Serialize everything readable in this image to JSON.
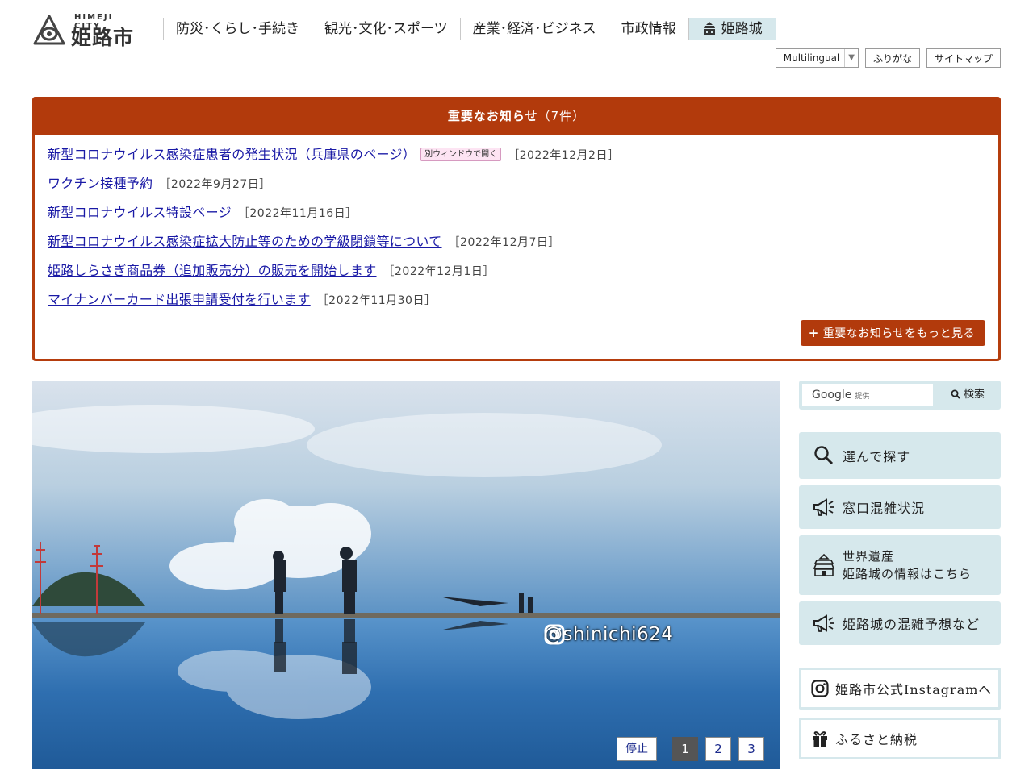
{
  "header": {
    "logo_en": "HIMEJI CITY",
    "logo_ja": "姫路市",
    "nav": [
      "防災･くらし･手続き",
      "観光･文化･スポーツ",
      "産業･経済･ビジネス",
      "市政情報",
      "姫路城"
    ],
    "util": {
      "multilingual": "Multilingual",
      "furigana": "ふりがな",
      "sitemap": "サイトマップ"
    }
  },
  "notices": {
    "title": "重要なお知らせ",
    "count": "（7件）",
    "new_window_badge": "別ウィンドウで開く",
    "items": [
      {
        "title": "新型コロナウイルス感染症患者の発生状況（兵庫県のページ）",
        "date": "［2022年12月2日］"
      },
      {
        "title": "ワクチン接種予約",
        "date": "［2022年9月27日］"
      },
      {
        "title": "新型コロナウイルス特設ページ",
        "date": "［2022年11月16日］"
      },
      {
        "title": "新型コロナウイルス感染症拡大防止等のための学級閉鎖等について",
        "date": "［2022年12月7日］"
      },
      {
        "title": "姫路しらさぎ商品券（追加販売分）の販売を開始します",
        "date": "［2022年12月1日］"
      },
      {
        "title": "マイナンバーカード出張申請受付を行います",
        "date": "［2022年11月30日］"
      }
    ],
    "more": "重要なお知らせをもっと見る"
  },
  "hero": {
    "credit": "@shinichi624",
    "stop": "停止",
    "pages": [
      "1",
      "2",
      "3"
    ],
    "active_page": "1"
  },
  "search": {
    "google": "Google",
    "provided": "提供",
    "button": "検索"
  },
  "side": {
    "find": "選んで探す",
    "window_status": "窓口混雑状況",
    "heritage_line1": "世界遺産",
    "heritage_line2": "姫路城の情報はこちら",
    "castle_crowd": "姫路城の混雑予想など",
    "instagram": "姫路市公式Instagramへ",
    "furusato": "ふるさと納税"
  },
  "colors": {
    "notice_accent": "#b23a0c",
    "side_bg": "#d6e8ec",
    "link": "#1a1aa6"
  },
  "icons": [
    "himeji-logo-icon",
    "castle-icon",
    "search-icon",
    "megaphone-icon",
    "instagram-icon",
    "gift-icon"
  ]
}
